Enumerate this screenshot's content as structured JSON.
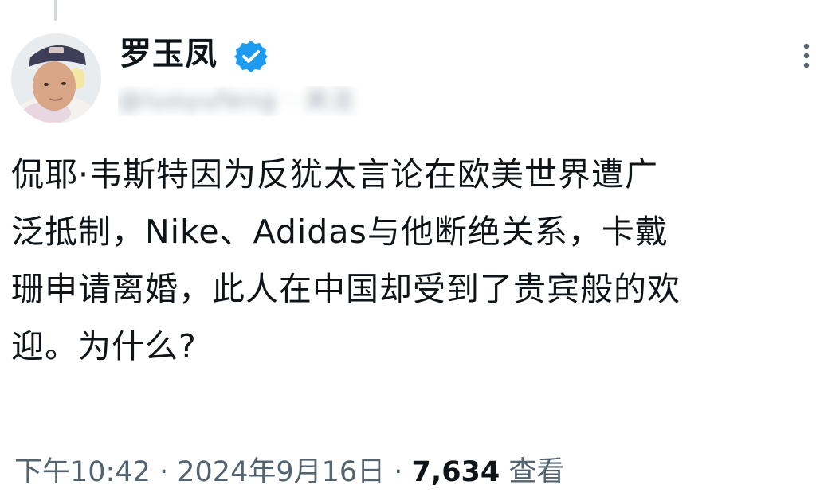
{
  "author": {
    "name": "罗玉凤",
    "verified": true,
    "handle": "@luoyufeng · 关注"
  },
  "tweet": {
    "lines": [
      "侃耶·韦斯特因为反犹太言论在欧美世界遭广",
      "泛抵制，Nike、Adidas与他断绝关系，卡戴",
      "珊申请离婚，此人在中国却受到了贵宾般的欢",
      "迎。为什么?"
    ]
  },
  "meta": {
    "time": "下午10:42",
    "separator": " · ",
    "date": "2024年9月16日",
    "views_count": "7,634",
    "views_label": "查看"
  },
  "icons": {
    "verified": "verified-badge-icon",
    "more": "more-vertical-icon"
  },
  "colors": {
    "verified": "#1d9bf0",
    "text": "#0f1419",
    "secondary": "#536471"
  }
}
